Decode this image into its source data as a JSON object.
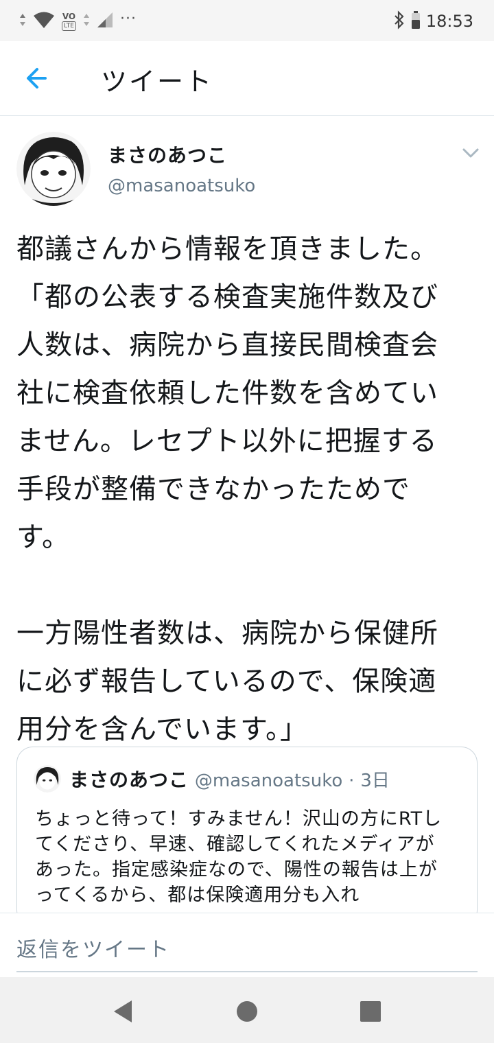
{
  "status_bar": {
    "time": "18:53",
    "volte_label": "VO",
    "lte_label": "LTE",
    "more_dots": "···"
  },
  "header": {
    "title": "ツイート",
    "back_icon": "arrow-left-icon"
  },
  "tweet": {
    "author_name": "まさのあつこ",
    "author_handle": "@masanoatsuko",
    "text": "都議さんから情報を頂きました。\n「都の公表する検査実施件数及び\n人数は、病院から直接民間検査会\n社に検査依頼した件数を含めてい\nません。レセプト以外に把握する\n手段が整備できなかったためで\nす。\n\n一方陽性者数は、病院から保健所\nに必ず報告しているので、保険適\n用分を含んでいます。」"
  },
  "quote": {
    "author_name": "まさのあつこ",
    "author_handle": "@masanoatsuko",
    "separator": "·",
    "time": "3日",
    "text": "ちょっと待って！すみません！沢山の方にRTしてくださり、早速、確認してくれたメディアがあった。指定感染症なので、陽性の報告は上がってくるから、都は保険適用分も入れ"
  },
  "reply": {
    "placeholder": "返信をツイート"
  },
  "colors": {
    "accent": "#1da1f2",
    "secondary_text": "#657786",
    "border": "#e1e8ed"
  }
}
